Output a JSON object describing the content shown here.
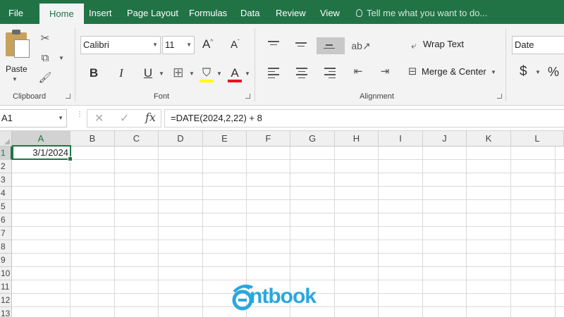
{
  "menu": {
    "tabs": [
      "File",
      "Home",
      "Insert",
      "Page Layout",
      "Formulas",
      "Data",
      "Review",
      "View"
    ],
    "active_tab": "Home",
    "tell_me": "Tell me what you want to do..."
  },
  "ribbon": {
    "clipboard": {
      "paste_label": "Paste",
      "group_label": "Clipboard"
    },
    "font": {
      "font_name": "Calibri",
      "font_size": "11",
      "grow_label": "A",
      "shrink_label": "A",
      "bold": "B",
      "italic": "I",
      "underline": "U",
      "font_color_label": "A",
      "group_label": "Font"
    },
    "alignment": {
      "wrap_text": "Wrap Text",
      "merge_center": "Merge & Center",
      "group_label": "Alignment"
    },
    "number": {
      "format": "Date",
      "currency": "$",
      "percent": "%"
    }
  },
  "formula_bar": {
    "name_box": "A1",
    "formula": "=DATE(2024,2,22) + 8"
  },
  "grid": {
    "columns": [
      "A",
      "B",
      "C",
      "D",
      "E",
      "F",
      "G",
      "H",
      "I",
      "J",
      "K",
      "L"
    ],
    "rows": [
      "1",
      "2",
      "3",
      "4",
      "5",
      "6",
      "7",
      "8",
      "9",
      "10",
      "11",
      "12",
      "13"
    ],
    "selected_cell": "A1",
    "cells": {
      "A1": "3/1/2024"
    }
  },
  "colors": {
    "excel_green": "#217346",
    "ribbon_bg": "#f3f3f3",
    "highlight_yellow": "#ffff00",
    "font_red": "#e81123",
    "watermark_blue": "#29a7e1"
  },
  "watermark": {
    "text": "ntbook"
  }
}
